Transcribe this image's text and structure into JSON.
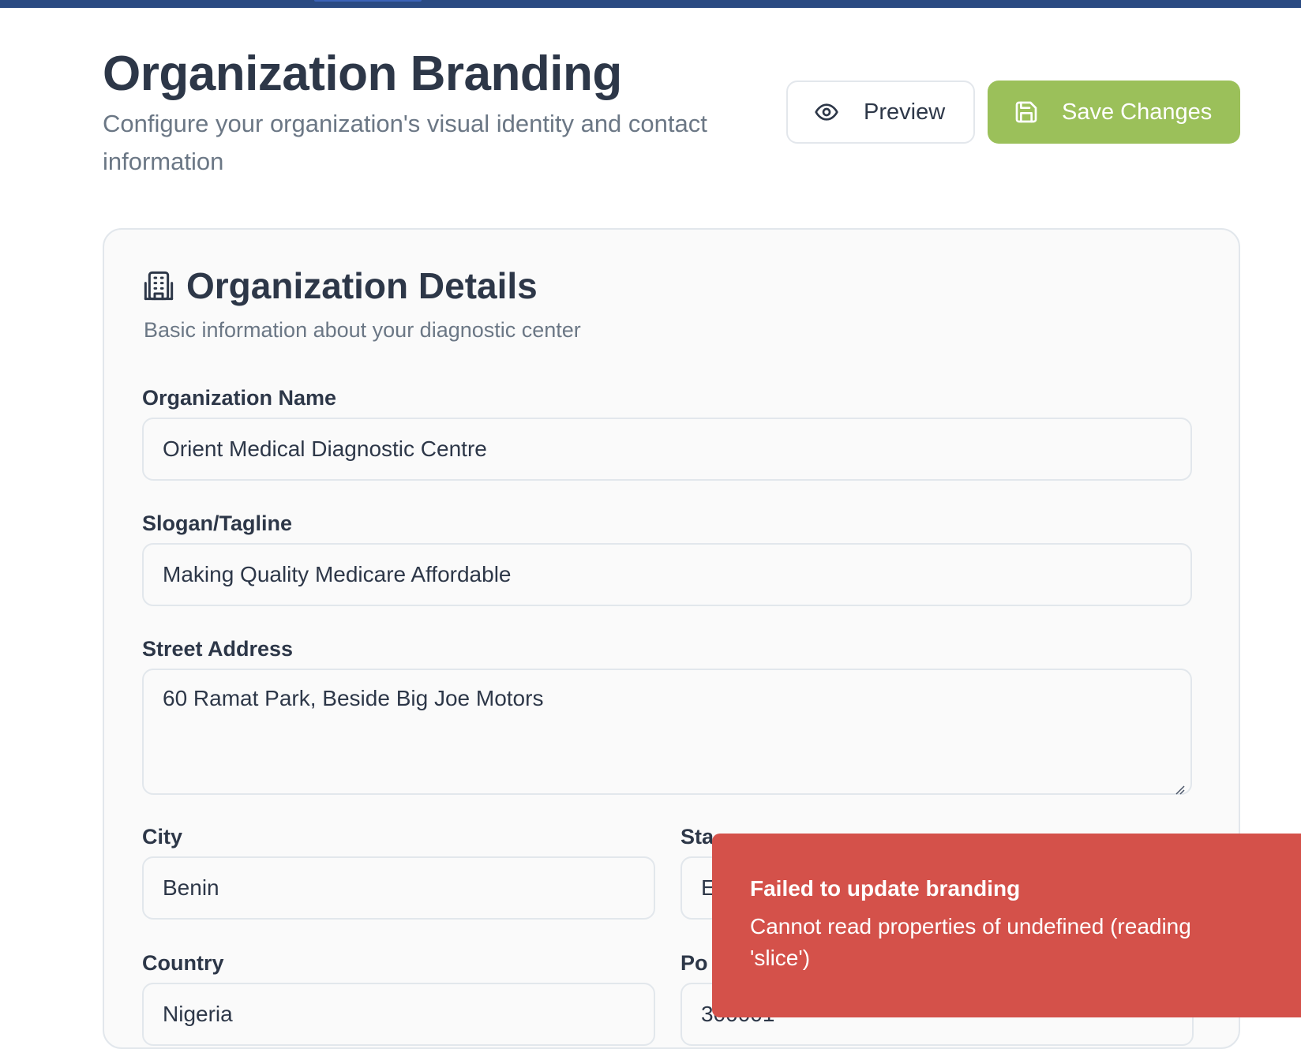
{
  "header": {
    "title": "Organization Branding",
    "subtitle": "Configure your organization's visual identity and contact information",
    "preview_label": "Preview",
    "save_label": "Save Changes"
  },
  "card": {
    "title": "Organization Details",
    "description": "Basic information about your diagnostic center",
    "fields": {
      "org_name": {
        "label": "Organization Name",
        "value": "Orient Medical Diagnostic Centre"
      },
      "slogan": {
        "label": "Slogan/Tagline",
        "value": "Making Quality Medicare Affordable"
      },
      "street": {
        "label": "Street Address",
        "value": "60 Ramat Park, Beside Big Joe Motors"
      },
      "city": {
        "label": "City",
        "value": "Benin"
      },
      "state": {
        "label": "Sta",
        "value": "E"
      },
      "country": {
        "label": "Country",
        "value": "Nigeria"
      },
      "postal": {
        "label": "Po",
        "value": "300001"
      }
    }
  },
  "toast": {
    "title": "Failed to update branding",
    "message": "Cannot read properties of undefined (reading 'slice')"
  },
  "colors": {
    "top_bar": "#2a4a82",
    "save_button": "#9bc05a",
    "toast_error": "#d4514a",
    "text_primary": "#2d3748",
    "text_muted": "#6b7785"
  },
  "icons": {
    "preview": "eye-icon",
    "save": "save-icon",
    "card": "building-icon"
  }
}
